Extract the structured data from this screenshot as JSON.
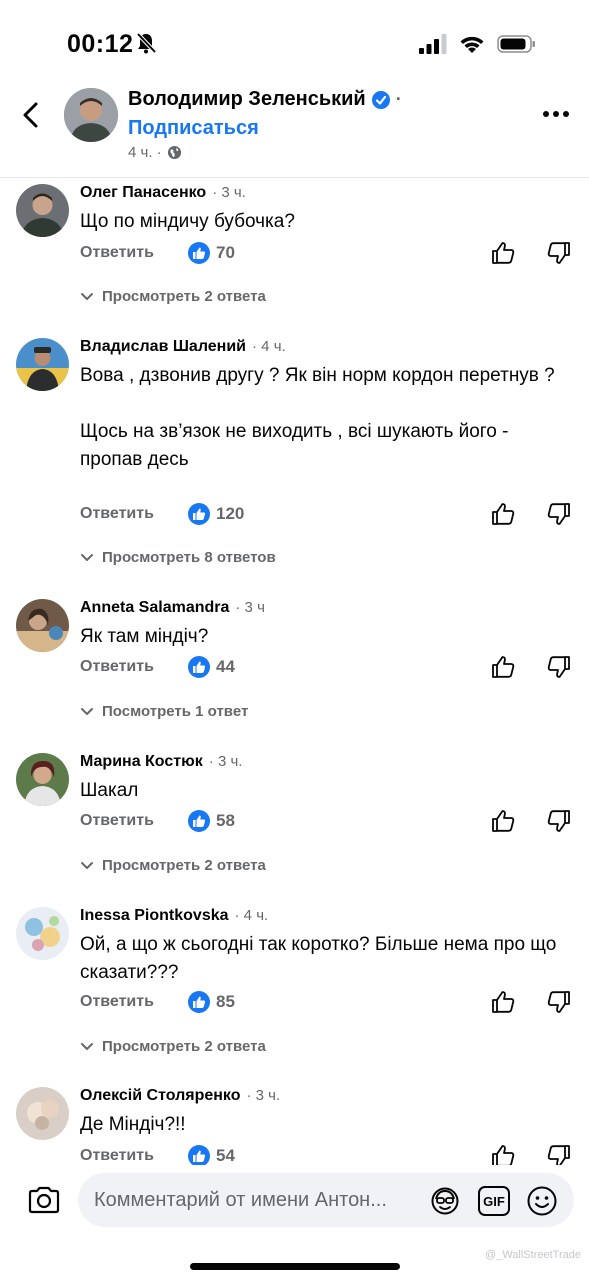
{
  "status_bar": {
    "time": "00:12"
  },
  "header": {
    "page_name": "Володимир Зеленський",
    "dot": "·",
    "subscribe_label": "Подписаться",
    "post_time": "4 ч. ·"
  },
  "comments": [
    {
      "author": "Олег Панасенко",
      "time": "· 3 ч.",
      "text": "Що по міндичу бубочка?",
      "reply_label": "Ответить",
      "likes": "70",
      "view_replies": "Просмотреть 2 ответа"
    },
    {
      "author": "Владислав Шалений",
      "time": "· 4 ч.",
      "text": "Вова , дзвонив другу ? Як він норм кордон перетнув ?\n\nЩось на зв’язок не виходить , всі шукають його  - пропав десь",
      "reply_label": "Ответить",
      "likes": "120",
      "view_replies": "Просмотреть 8 ответов"
    },
    {
      "author": "Anneta Salamandra",
      "time": "· 3 ч",
      "text": "Як там міндіч?",
      "reply_label": "Ответить",
      "likes": "44",
      "view_replies": "Посмотреть 1 ответ"
    },
    {
      "author": "Марина Костюк",
      "time": "· 3 ч.",
      "text": "Шакал",
      "reply_label": "Ответить",
      "likes": "58",
      "view_replies": "Просмотреть 2 ответа"
    },
    {
      "author": "Inessa Piontkovska",
      "time": "· 4 ч.",
      "text": "Ой, а що ж сьогодні так коротко? Більше нема про що сказати???",
      "reply_label": "Ответить",
      "likes": "85",
      "view_replies": "Просмотреть 2 ответа"
    },
    {
      "author": "Олексій Столяренко",
      "time": "· 3 ч.",
      "text": "Де Міндіч?!!",
      "reply_label": "Ответить",
      "likes": "54"
    }
  ],
  "composer": {
    "placeholder": "Комментарий от имени Антон...",
    "gif_label": "GIF"
  },
  "watermark": "@_WallStreetTrade",
  "colors": {
    "accent": "#1877f2",
    "secondary_text": "#65676b",
    "input_bg": "#f0f2f5"
  }
}
